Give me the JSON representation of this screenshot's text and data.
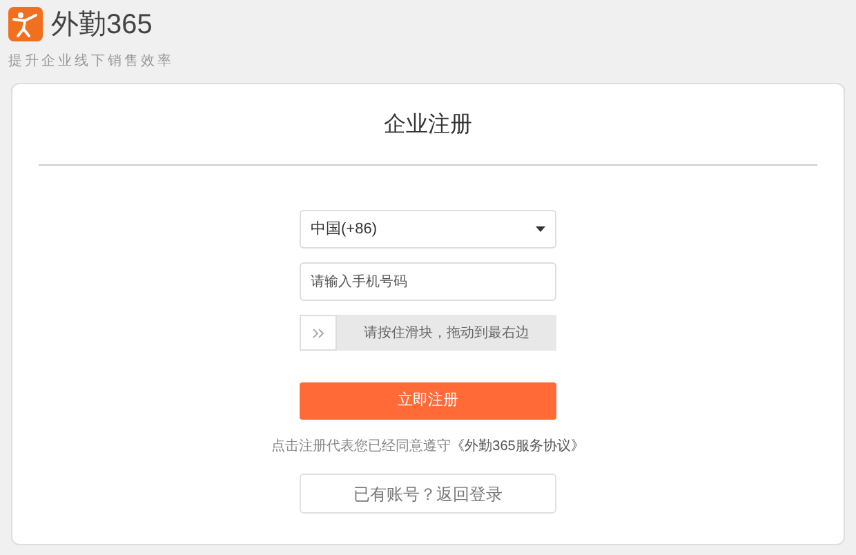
{
  "header": {
    "brand": "外勤365",
    "slogan": "提升企业线下销售效率"
  },
  "card": {
    "title": "企业注册",
    "country_select": {
      "value": "中国(+86)"
    },
    "phone_field": {
      "placeholder": "请输入手机号码"
    },
    "slider": {
      "hint": "请按住滑块，拖动到最右边"
    },
    "submit_button": "立即注册",
    "terms": {
      "text": "点击注册代表您已经同意遵守",
      "link": "《外勤365服务协议》"
    },
    "login_link": "已有账号？返回登录"
  }
}
